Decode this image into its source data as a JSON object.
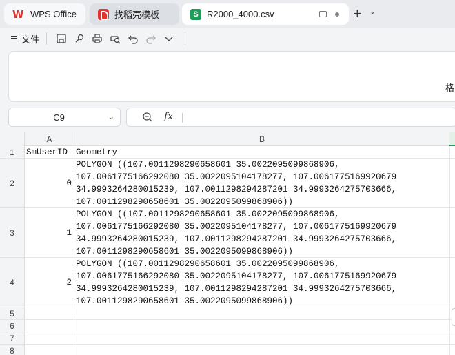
{
  "tabs": [
    {
      "label": "WPS Office"
    },
    {
      "label": "找稻壳模板"
    },
    {
      "label": "R2000_4000.csv"
    }
  ],
  "toolbar": {
    "file_menu_label": "文件",
    "icons": [
      "save-icon",
      "share-icon",
      "print-icon",
      "print-preview-icon",
      "undo-icon",
      "redo-icon",
      "more-chevron-icon"
    ]
  },
  "ribbon": {
    "clipped_text": "格"
  },
  "namebox": {
    "value": "C9"
  },
  "formula": {
    "fx_label": "fx",
    "value": ""
  },
  "columns": [
    "A",
    "B"
  ],
  "rows": [
    {
      "num": "1",
      "a": "SmUserID",
      "b": "Geometry"
    },
    {
      "num": "2",
      "a": "0",
      "b": "POLYGON ((107.0011298290658601 35.0022095099868906,\n107.0061775166292080 35.0022095104178277, 107.0061775169920679\n34.9993264280015239, 107.0011298294287201 34.9993264275703666,\n107.0011298290658601 35.0022095099868906))"
    },
    {
      "num": "3",
      "a": "1",
      "b": "POLYGON ((107.0011298290658601 35.0022095099868906,\n107.0061775166292080 35.0022095104178277, 107.0061775169920679\n34.9993264280015239, 107.0011298294287201 34.9993264275703666,\n107.0011298290658601 35.0022095099868906))"
    },
    {
      "num": "4",
      "a": "2",
      "b": "POLYGON ((107.0011298290658601 35.0022095099868906,\n107.0061775166292080 35.0022095104178277, 107.0061775169920679\n34.9993264280015239, 107.0011298294287201 34.9993264275703666,\n107.0011298290658601 35.0022095099868906))"
    },
    {
      "num": "5",
      "a": "",
      "b": ""
    },
    {
      "num": "6",
      "a": "",
      "b": ""
    },
    {
      "num": "7",
      "a": "",
      "b": ""
    },
    {
      "num": "8",
      "a": "",
      "b": ""
    }
  ],
  "colors": {
    "accent_green": "#1c9e5a",
    "wps_red": "#e5312f"
  }
}
